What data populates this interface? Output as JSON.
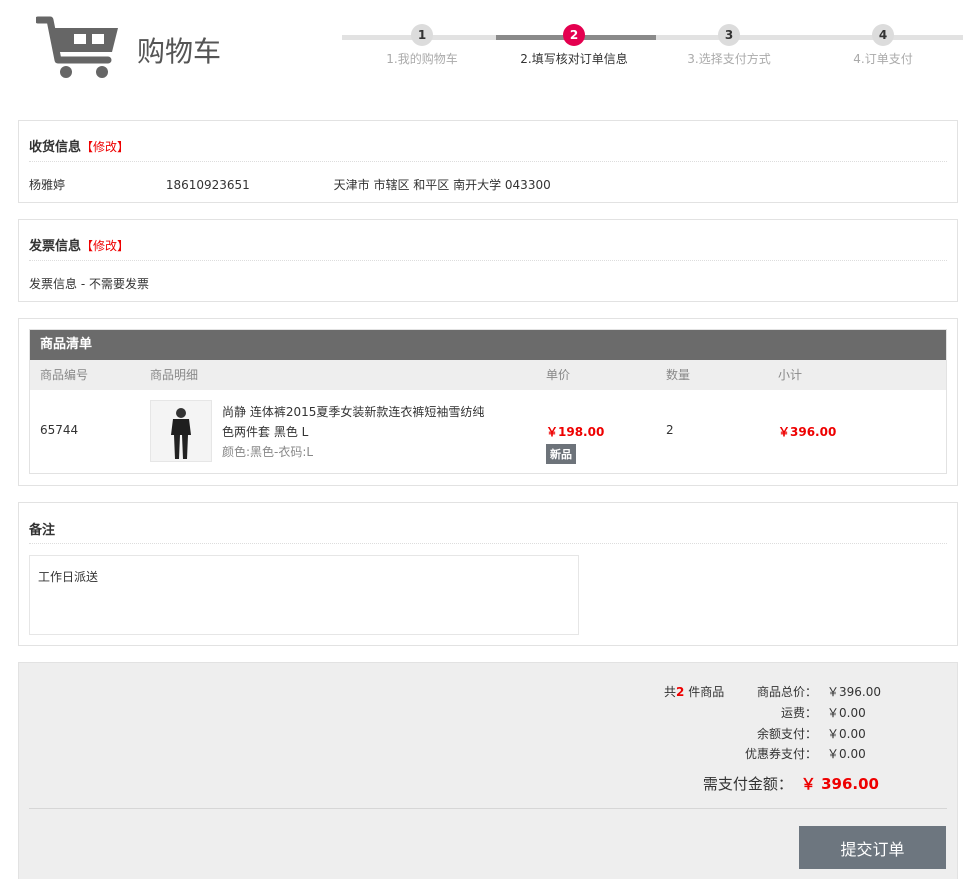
{
  "header": {
    "title": "购物车",
    "steps": [
      {
        "num": "1",
        "label": "1.我的购物车"
      },
      {
        "num": "2",
        "label": "2.填写核对订单信息"
      },
      {
        "num": "3",
        "label": "3.选择支付方式"
      },
      {
        "num": "4",
        "label": "4.订单支付"
      }
    ],
    "active_step": 2
  },
  "address": {
    "title": "收货信息",
    "edit": "【修改】",
    "name": "杨雅婷",
    "phone": "18610923651",
    "location": "天津市 市辖区 和平区 南开大学 043300"
  },
  "invoice": {
    "title": "发票信息",
    "edit": "【修改】",
    "text": "发票信息 - 不需要发票"
  },
  "goods": {
    "title": "商品清单",
    "columns": {
      "id": "商品编号",
      "detail": "商品明细",
      "price": "单价",
      "qty": "数量",
      "subtotal": "小计"
    },
    "item": {
      "id": "65744",
      "name": "尚静 连体裤2015夏季女装新款连衣裤短袖雪纺纯色两件套 黑色 L",
      "spec": "颜色:黑色-衣码:L",
      "price": "￥198.00",
      "tag": "新品",
      "qty": "2",
      "subtotal": "￥396.00"
    }
  },
  "remark": {
    "title": "备注",
    "value": "工作日派送"
  },
  "summary": {
    "count_prefix": "共",
    "count": "2",
    "count_suffix": "件商品",
    "lines": [
      {
        "label": "商品总价：",
        "value": "￥396.00"
      },
      {
        "label": "运费：",
        "value": "￥0.00"
      },
      {
        "label": "余额支付：",
        "value": "￥0.00"
      },
      {
        "label": "优惠券支付：",
        "value": "￥0.00"
      }
    ],
    "total_label": "需支付金额：",
    "total_value": "￥ 396.00",
    "submit": "提交订单"
  },
  "colors": {
    "accent": "#e4004f",
    "price": "#ee0000",
    "button": "#6d767f"
  }
}
